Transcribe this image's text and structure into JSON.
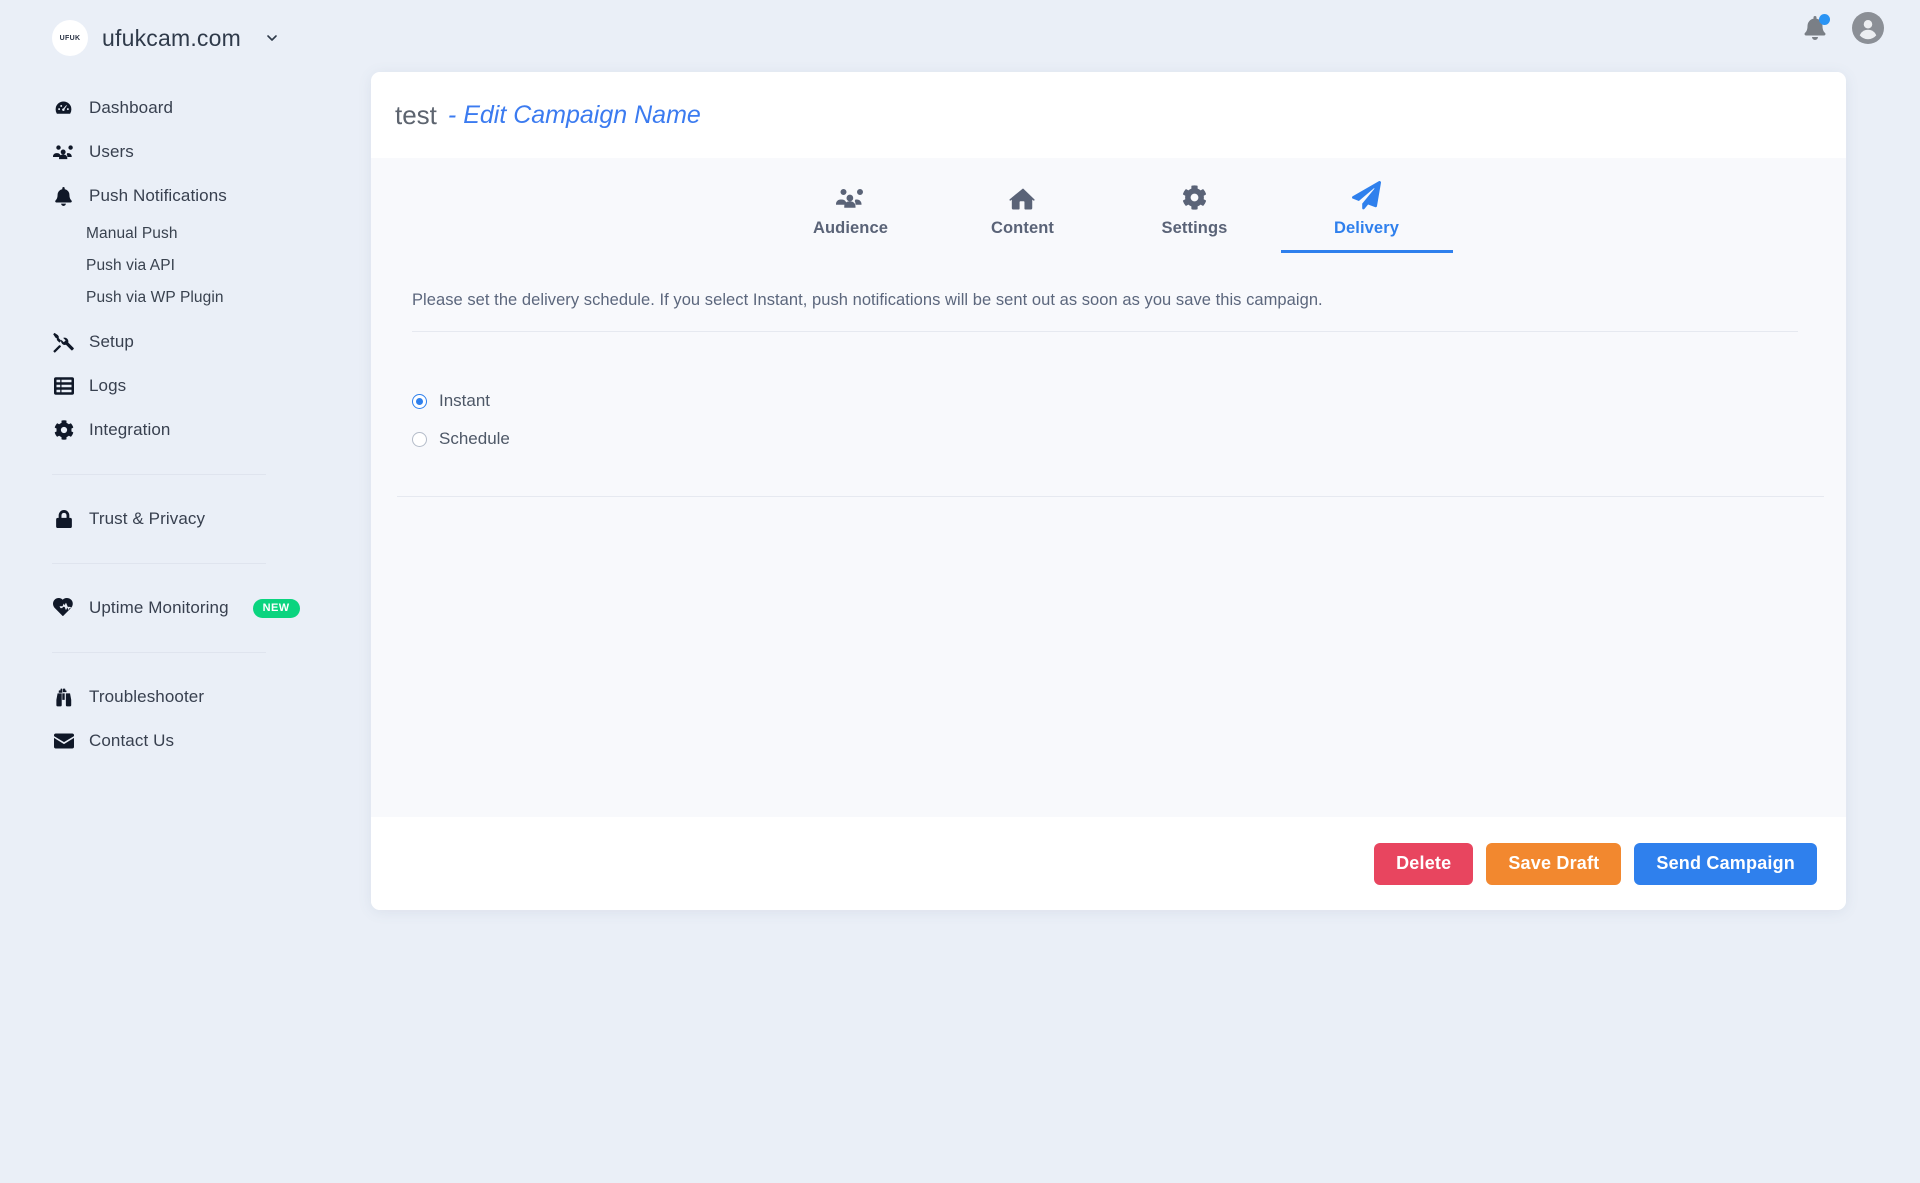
{
  "brand": {
    "logo_text": "UFUK",
    "name": "ufukcam.com",
    "caret_icon": "chevron-down-icon"
  },
  "topbar": {
    "notifications_icon": "bell-icon",
    "has_unread": true,
    "account_icon": "user-avatar-icon"
  },
  "sidebar": {
    "items": [
      {
        "label": "Dashboard",
        "icon": "gauge-icon"
      },
      {
        "label": "Users",
        "icon": "users-icon"
      },
      {
        "label": "Push Notifications",
        "icon": "bell-icon"
      }
    ],
    "sub_items": [
      {
        "label": "Manual Push"
      },
      {
        "label": "Push via API"
      },
      {
        "label": "Push via WP Plugin"
      }
    ],
    "items2": [
      {
        "label": "Setup",
        "icon": "tools-icon"
      },
      {
        "label": "Logs",
        "icon": "list-icon"
      },
      {
        "label": "Integration",
        "icon": "gear-icon"
      }
    ],
    "privacy": {
      "label": "Trust & Privacy",
      "icon": "lock-icon"
    },
    "uptime": {
      "label": "Uptime Monitoring",
      "icon": "heartbeat-icon",
      "badge": "NEW"
    },
    "support": [
      {
        "label": "Troubleshooter",
        "icon": "binoculars-icon"
      },
      {
        "label": "Contact Us",
        "icon": "envelope-icon"
      }
    ]
  },
  "card": {
    "title": "test",
    "title_link": "- Edit Campaign Name",
    "tabs": [
      {
        "label": "Audience",
        "icon": "users-icon",
        "active": false
      },
      {
        "label": "Content",
        "icon": "home-icon",
        "active": false
      },
      {
        "label": "Settings",
        "icon": "gear-icon",
        "active": false
      },
      {
        "label": "Delivery",
        "icon": "paper-plane-icon",
        "active": true
      }
    ],
    "description": "Please set the delivery schedule. If you select Instant, push notifications will be sent out as soon as you save this campaign.",
    "radios": [
      {
        "label": "Instant",
        "checked": true
      },
      {
        "label": "Schedule",
        "checked": false
      }
    ],
    "buttons": {
      "delete": "Delete",
      "save_draft": "Save Draft",
      "send": "Send Campaign"
    }
  },
  "colors": {
    "accent": "#2f80ed",
    "delete": "#e8455f",
    "draft": "#f2882f",
    "badge_new": "#0bd47f",
    "page_bg": "#eaeff7"
  }
}
